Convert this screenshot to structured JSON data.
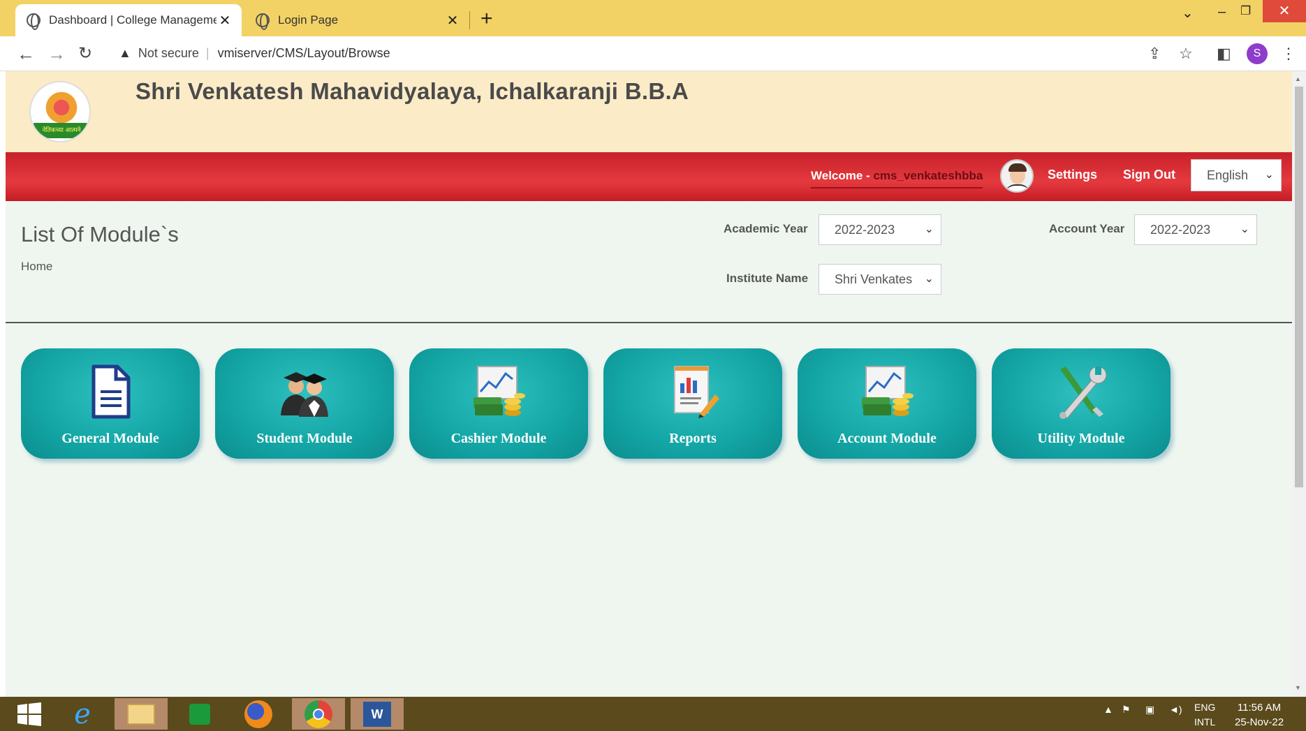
{
  "browser": {
    "tabs": [
      {
        "title": "Dashboard | College Managemen"
      },
      {
        "title": "Login Page"
      }
    ],
    "new_tab": "+",
    "address": {
      "warning": "Not secure",
      "url": "vmiserver/CMS/Layout/Browse"
    },
    "profile_initial": "S"
  },
  "header": {
    "title": "Shri Venkatesh Mahavidyalaya, Ichalkaranji B.B.A",
    "logo_text": "नेतिकच्या आत्मने"
  },
  "topnav": {
    "welcome_label": "Welcome - ",
    "username": "cms_venkateshbba",
    "settings": "Settings",
    "sign_out": "Sign Out",
    "language": "English"
  },
  "page": {
    "title": "List Of Module`s",
    "breadcrumb": "Home"
  },
  "filters": {
    "academic_year_label": "Academic Year",
    "academic_year_value": "2022-2023",
    "account_year_label": "Account Year",
    "account_year_value": "2022-2023",
    "institute_label": "Institute Name",
    "institute_value": "Shri Venkates"
  },
  "modules": [
    {
      "label": "General Module",
      "icon": "document-icon"
    },
    {
      "label": "Student Module",
      "icon": "students-icon"
    },
    {
      "label": "Cashier Module",
      "icon": "cash-chart-icon"
    },
    {
      "label": "Reports",
      "icon": "report-icon"
    },
    {
      "label": "Account Module",
      "icon": "cash-chart-icon"
    },
    {
      "label": "Utility Module",
      "icon": "tools-icon"
    }
  ],
  "taskbar": {
    "lang_top": "ENG",
    "lang_bottom": "INTL",
    "time": "11:56 AM",
    "date": "25-Nov-22"
  },
  "colors": {
    "header_bg": "#fcebc7",
    "nav_red": "#d62b33",
    "tile_teal": "#14a7a6",
    "page_bg": "#eef6ef",
    "taskbar": "#5a4a1c"
  }
}
